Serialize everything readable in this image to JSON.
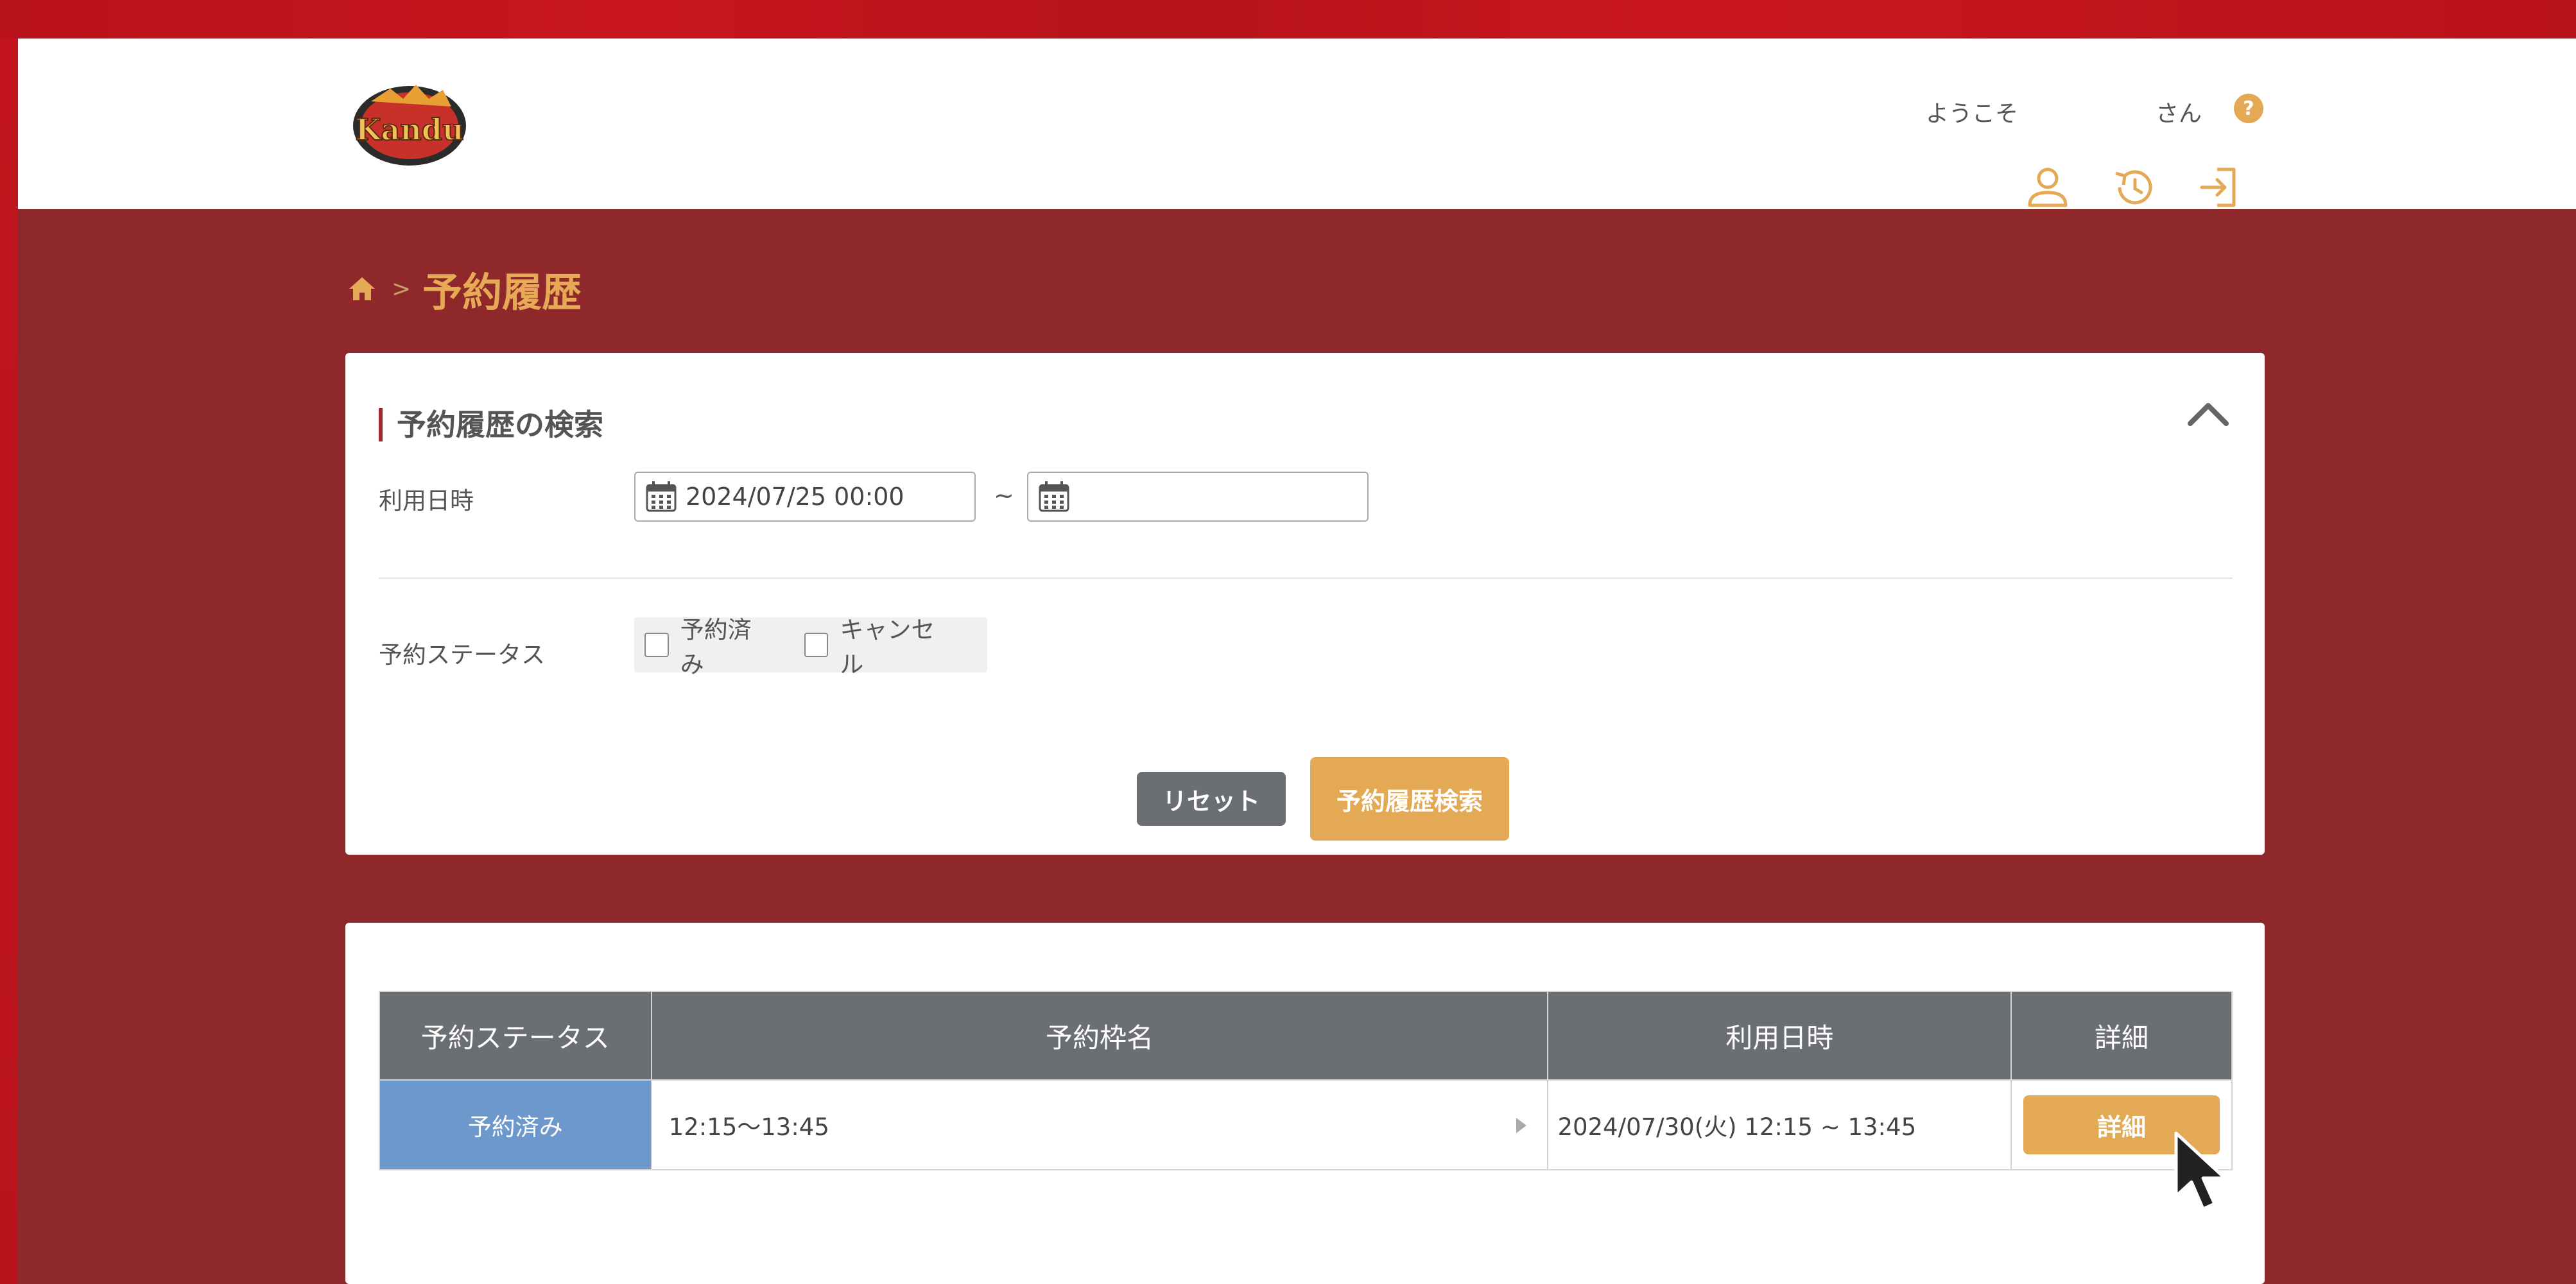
{
  "header": {
    "welcome_prefix": "ようこそ",
    "welcome_suffix": "さん",
    "logo_text": "Kandu",
    "icons": [
      "help-icon",
      "user-icon",
      "history-icon",
      "logout-icon"
    ]
  },
  "breadcrumb": {
    "separator": ">",
    "title": "予約履歴"
  },
  "search": {
    "section_title": "予約履歴の検索",
    "date_label": "利用日時",
    "date_from": "2024/07/25 00:00",
    "date_to": "",
    "tilde": "~",
    "status_label": "予約ステータス",
    "status_options": [
      "予約済み",
      "キャンセル"
    ],
    "reset_label": "リセット",
    "search_label": "予約履歴検索"
  },
  "results": {
    "columns": [
      "予約ステータス",
      "予約枠名",
      "利用日時",
      "詳細"
    ],
    "rows": [
      {
        "status": "予約済み",
        "name": "12:15〜13:45",
        "datetime": "2024/07/30(火) 12:15 ~ 13:45",
        "detail_label": "詳細"
      }
    ]
  },
  "colors": {
    "accent": "#e4a955",
    "background": "#8f282b",
    "header_bg": "#6b6e73",
    "status_blue": "#6c98cc"
  }
}
